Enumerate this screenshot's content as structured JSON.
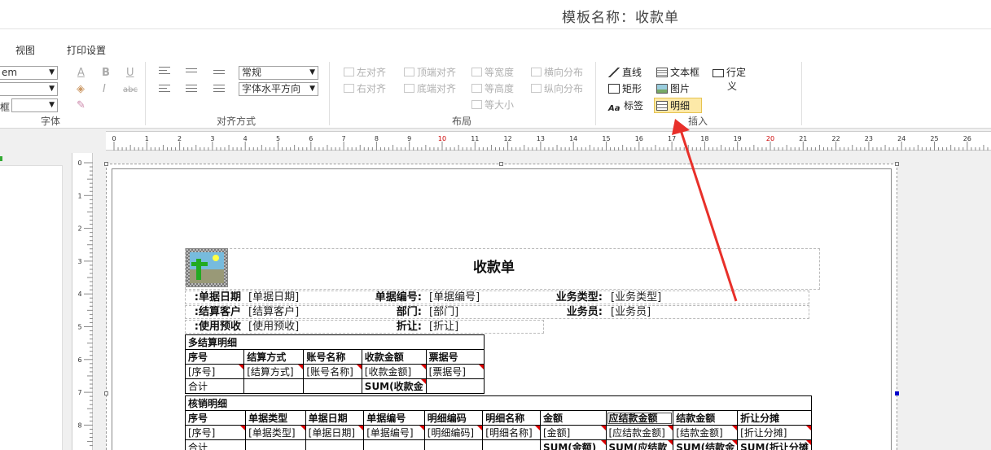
{
  "window": {
    "template_title": "模板名称：收款单"
  },
  "menu": [
    {
      "label": "视图"
    },
    {
      "label": "打印设置"
    }
  ],
  "ribbon": {
    "font_group": {
      "label": "字体",
      "font_name": "em",
      "font_size": "",
      "border_label": "框",
      "border_value": "",
      "glyph_color": "A",
      "glyph_bold": "B",
      "glyph_italic": "I",
      "glyph_underline": "U",
      "glyph_strike": "abc"
    },
    "align_group": {
      "label": "对齐方式",
      "format_value": "常规",
      "text_dir_value": "字体水平方向"
    },
    "layout_group": {
      "label": "布局",
      "buttons": [
        {
          "label": "左对齐"
        },
        {
          "label": "右对齐"
        },
        {
          "label": "顶端对齐"
        },
        {
          "label": "底端对齐"
        },
        {
          "label": "等宽度"
        },
        {
          "label": "等高度"
        },
        {
          "label": "等大小"
        },
        {
          "label": "横向分布"
        },
        {
          "label": "纵向分布"
        }
      ]
    },
    "insert_group": {
      "label": "插入",
      "buttons": [
        {
          "label": "直线"
        },
        {
          "label": "矩形"
        },
        {
          "label": "标签"
        },
        {
          "label": "文本框"
        },
        {
          "label": "图片"
        },
        {
          "label": "明细"
        },
        {
          "label": "行定"
        },
        {
          "label": "义"
        }
      ]
    }
  },
  "ruler": {
    "h_ticks": [
      "0",
      "1",
      "2",
      "3",
      "4",
      "5",
      "6",
      "7",
      "8",
      "9",
      "10",
      "11",
      "12",
      "13",
      "14",
      "15",
      "16",
      "17",
      "18",
      "19",
      "20",
      "21",
      "22",
      "23",
      "24",
      "25",
      "26"
    ],
    "v_ticks": [
      "0",
      "1",
      "2",
      "3",
      "4",
      "5",
      "6",
      "7",
      "8"
    ],
    "accent_color": "#cc0000"
  },
  "report": {
    "title": "收款单",
    "header_rows": [
      [
        {
          "label": "单据日期:",
          "value": "[单据日期]"
        },
        {
          "label": "单据编号:",
          "value": "[单据编号]"
        },
        {
          "label": "业务类型:",
          "value": "[业务类型]"
        }
      ],
      [
        {
          "label": "结算客户:",
          "value": "[结算客户]"
        },
        {
          "label": "部门:",
          "value": "[部门]"
        },
        {
          "label": "业务员:",
          "value": "[业务员]"
        }
      ],
      [
        {
          "label": "使用预收:",
          "value": "[使用预收]"
        },
        {
          "label": "折让:",
          "value": "[折让]"
        }
      ]
    ],
    "settlement": {
      "title": "多结算明细",
      "headers": [
        "序号",
        "结算方式",
        "账号名称",
        "收款金额",
        "票据号"
      ],
      "row": [
        "[序号]",
        "[结算方式]",
        "[账号名称]",
        "[收款金额]",
        "[票据号]"
      ],
      "total": [
        "合计",
        "",
        "",
        "SUM(收款金",
        ""
      ]
    },
    "writeoff": {
      "title": "核销明细",
      "headers": [
        "序号",
        "单据类型",
        "单据日期",
        "单据编号",
        "明细编码",
        "明细名称",
        "金额",
        "应结款金额",
        "结款金额",
        "折让分摊"
      ],
      "row": [
        "[序号]",
        "[单据类型]",
        "[单据日期]",
        "[单据编号]",
        "[明细编码]",
        "[明细名称]",
        "[金额]",
        "[应结款金额]",
        "[结款金额]",
        "[折让分摊]"
      ],
      "total": [
        "合计",
        "",
        "",
        "",
        "",
        "",
        "SUM(金额)",
        "SUM(应结款",
        "SUM(结款金",
        "SUM(折让分摊"
      ]
    }
  },
  "annotation": {
    "color": "#e8302a",
    "target": "明细"
  }
}
